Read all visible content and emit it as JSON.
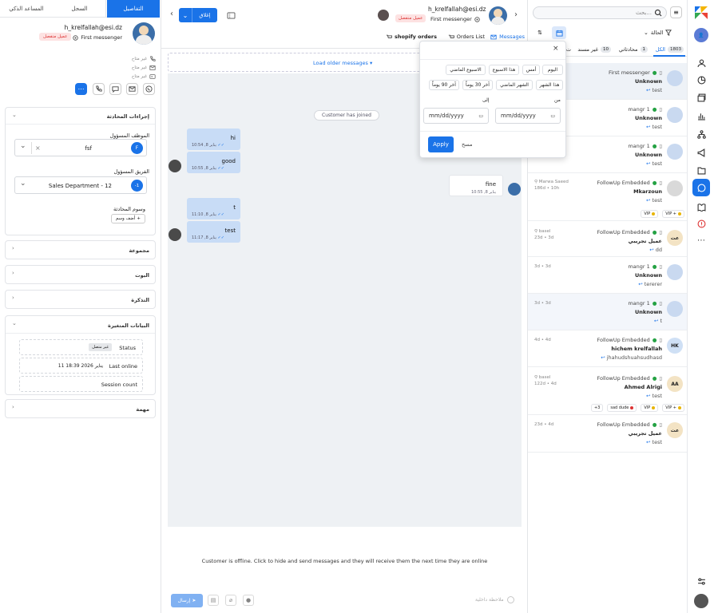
{
  "brand": {
    "accent": "#1a73e8",
    "offline_badge_bg": "#fde2e2",
    "offline_badge_fg": "#d33"
  },
  "rail": {
    "icons": [
      "logo-icon",
      "user-avatar-icon",
      "user-icon",
      "pie-chart-icon",
      "layers-icon",
      "bar-chart-icon",
      "hierarchy-icon",
      "megaphone-icon",
      "folder-icon",
      "chat-icon",
      "book-icon",
      "info-icon",
      "more-icon",
      "settings-sliders-icon",
      "profile-avatar-icon"
    ]
  },
  "list": {
    "search_placeholder": "بحث...",
    "status_label": "الحالة",
    "tabs": [
      {
        "label": "الكل",
        "count": "1803",
        "active": true
      },
      {
        "label": "محادثاتي",
        "count": "1",
        "active": false
      },
      {
        "label": "غير مسند",
        "count": "10",
        "active": false
      },
      {
        "label": "ت",
        "count": "",
        "active": false
      }
    ],
    "conversations": [
      {
        "source": "First messenger",
        "name": "Unknown",
        "preview": "test",
        "meta": "",
        "tags": [],
        "avatar": "",
        "avatar_color": "#c9d9f0"
      },
      {
        "source": "mangr 1",
        "name": "Unknown",
        "preview": "test",
        "meta": "",
        "tags": [],
        "avatar": "",
        "avatar_color": "#c9d9f0"
      },
      {
        "source": "mangr 1",
        "name": "Unknown",
        "preview": "test",
        "meta": "",
        "tags": [],
        "avatar": "",
        "avatar_color": "#c9d9f0"
      },
      {
        "source": "FollowUp Embedded",
        "name": "Mkarzoun",
        "preview": "test",
        "meta": "Marwa Saeed",
        "meta2": "186d • 10h",
        "tags": [
          {
            "label": "VIP",
            "color": "#e8b400"
          },
          {
            "label": "VIP +",
            "color": "#e8b400"
          }
        ],
        "avatar": "",
        "avatar_color": "#d9d9d9"
      },
      {
        "source": "FollowUp Embedded",
        "name": "عميل تجريبي",
        "preview": "dd",
        "meta": "basel",
        "meta2": "23d • 3d",
        "tags": [],
        "avatar": "عت",
        "avatar_color": "#f3e3c4"
      },
      {
        "source": "mangr 1",
        "name": "Unknown",
        "preview": "tererer",
        "meta": "",
        "meta2": "3d • 3d",
        "tags": [],
        "avatar": "",
        "avatar_color": "#c9d9f0"
      },
      {
        "source": "mangr 1",
        "name": "Unknown",
        "preview": "t",
        "meta": "",
        "meta2": "3d • 3d",
        "tags": [],
        "avatar": "",
        "avatar_color": "#c9d9f0"
      },
      {
        "source": "FollowUp Embedded",
        "name": "hichem krelfallah",
        "preview": "jhahudshuahsudhasd",
        "meta": "",
        "meta2": "4d • 4d",
        "tags": [],
        "avatar": "HK",
        "avatar_color": "#cfe0f5"
      },
      {
        "source": "FollowUp Embedded",
        "name": "Ahmed Alrigi",
        "preview": "test",
        "meta": "basel",
        "meta2": "122d • 4d",
        "tags": [
          {
            "label": "+3",
            "color": ""
          },
          {
            "label": "sad dude",
            "color": "#d33"
          },
          {
            "label": "VIP",
            "color": "#e8b400"
          },
          {
            "label": "VIP +",
            "color": "#e8b400"
          }
        ],
        "avatar": "AA",
        "avatar_color": "#f3e3c4"
      },
      {
        "source": "FollowUp Embedded",
        "name": "عميل تجريبي",
        "preview": "test",
        "meta": "",
        "meta2": "23d • 4d",
        "tags": [],
        "avatar": "عت",
        "avatar_color": "#f3e3c4"
      }
    ]
  },
  "chat": {
    "contact_email": "h_krelfallah@esi.dz",
    "contact_source": "First messenger",
    "offline_badge": "عميل منفصل",
    "close_button": "إغلاق",
    "tabs": {
      "messages": "Messages",
      "orders": "Orders List",
      "shopify": "shopify orders"
    },
    "load_older": "Load older messages",
    "system_msg": "Customer has joined",
    "messages": [
      {
        "text": "hi",
        "time": "10:54 ,8 يناير",
        "dir": "out"
      },
      {
        "text": "good",
        "time": "10:55 ,8 يناير",
        "dir": "out"
      },
      {
        "text": "fine",
        "time": "10:55 ,8 يناير",
        "dir": "in"
      },
      {
        "text": "t",
        "time": "11:10 ,8 يناير",
        "dir": "out"
      },
      {
        "text": "test",
        "time": "11:17 ,8 يناير",
        "dir": "out"
      }
    ],
    "offline_notice": "Customer is offline. Click to hide and send messages and they will receive them the next time they are online",
    "send_button": "إرسال",
    "internal_note": "ملاحظة داخلية"
  },
  "datefilter": {
    "presets_row1": [
      "اليوم",
      "أمس",
      "هذا الاسبوع",
      "الاسبوع الماضي"
    ],
    "presets_row2": [
      "هذا الشهر",
      "الشهر الماضي",
      "آخر 30 يوماً",
      "آخر 90 يوماً"
    ],
    "to_label": "إلى",
    "from_label": "من",
    "date_placeholder": "mm/dd/yyyy",
    "apply": "Apply",
    "clear": "مسح"
  },
  "left": {
    "tabs": [
      "التفاصيل",
      "السجل",
      "المساعد الذكي"
    ],
    "email": "h_krelfallah@esi.dz",
    "source": "First messenger",
    "offline_badge": "عميل منفصل",
    "unavailable": [
      "غير متاح",
      "غير متاح",
      "غير متاح"
    ],
    "sections": {
      "actions": "إجراءات المحادثة",
      "assignee_label": "الموظف المسؤول",
      "assignee_value": "fsf",
      "assignee_initial": "F",
      "team_label": "الفريق المسؤول",
      "team_value": "Sales Department - 12",
      "team_initial": "-1",
      "tags_label": "وسوم المحادثة",
      "add_tag": "أضف وسم",
      "group": "مجموعة",
      "bots": "البوت",
      "ticket": "التذكرة",
      "smart_data": "البيانات المتغيرة",
      "status_label": "Status",
      "status_value": "غير متصل",
      "last_online_label": "Last online",
      "last_online_value": "11 يناير 2026 18:39",
      "session_label": "Session count",
      "task": "مهمة"
    }
  }
}
